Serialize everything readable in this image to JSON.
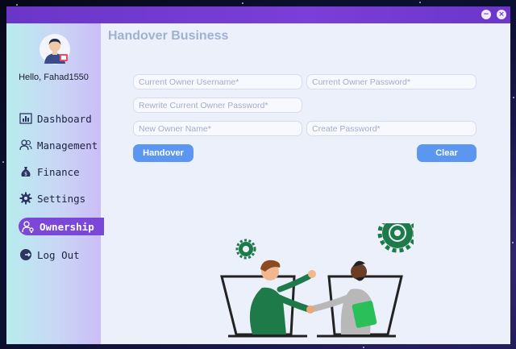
{
  "window": {
    "minimize_glyph": "−",
    "close_glyph": "×"
  },
  "colors": {
    "titlebar": "#7a3fd6",
    "accent": "#7b47d6",
    "button": "#5b97f0"
  },
  "sidebar": {
    "greeting": "Hello, Fahad1550",
    "items": [
      {
        "label": "Dashboard",
        "icon": "bar-chart-icon"
      },
      {
        "label": "Management",
        "icon": "users-icon"
      },
      {
        "label": "Finance",
        "icon": "money-bag-icon"
      },
      {
        "label": "Settings",
        "icon": "gear-icon"
      },
      {
        "label": "Ownership",
        "icon": "user-key-icon",
        "active": true
      },
      {
        "label": "Log Out",
        "icon": "logout-icon"
      }
    ]
  },
  "main": {
    "title": "Handover Business",
    "form": {
      "current_username_placeholder": "Current Owner Username*",
      "current_password_placeholder": "Current Owner Password*",
      "rewrite_password_placeholder": "Rewrite Current Owner Password*",
      "new_owner_placeholder": "New Owner Name*",
      "create_password_placeholder": "Create Password*",
      "handover_label": "Handover",
      "clear_label": "Clear"
    }
  }
}
